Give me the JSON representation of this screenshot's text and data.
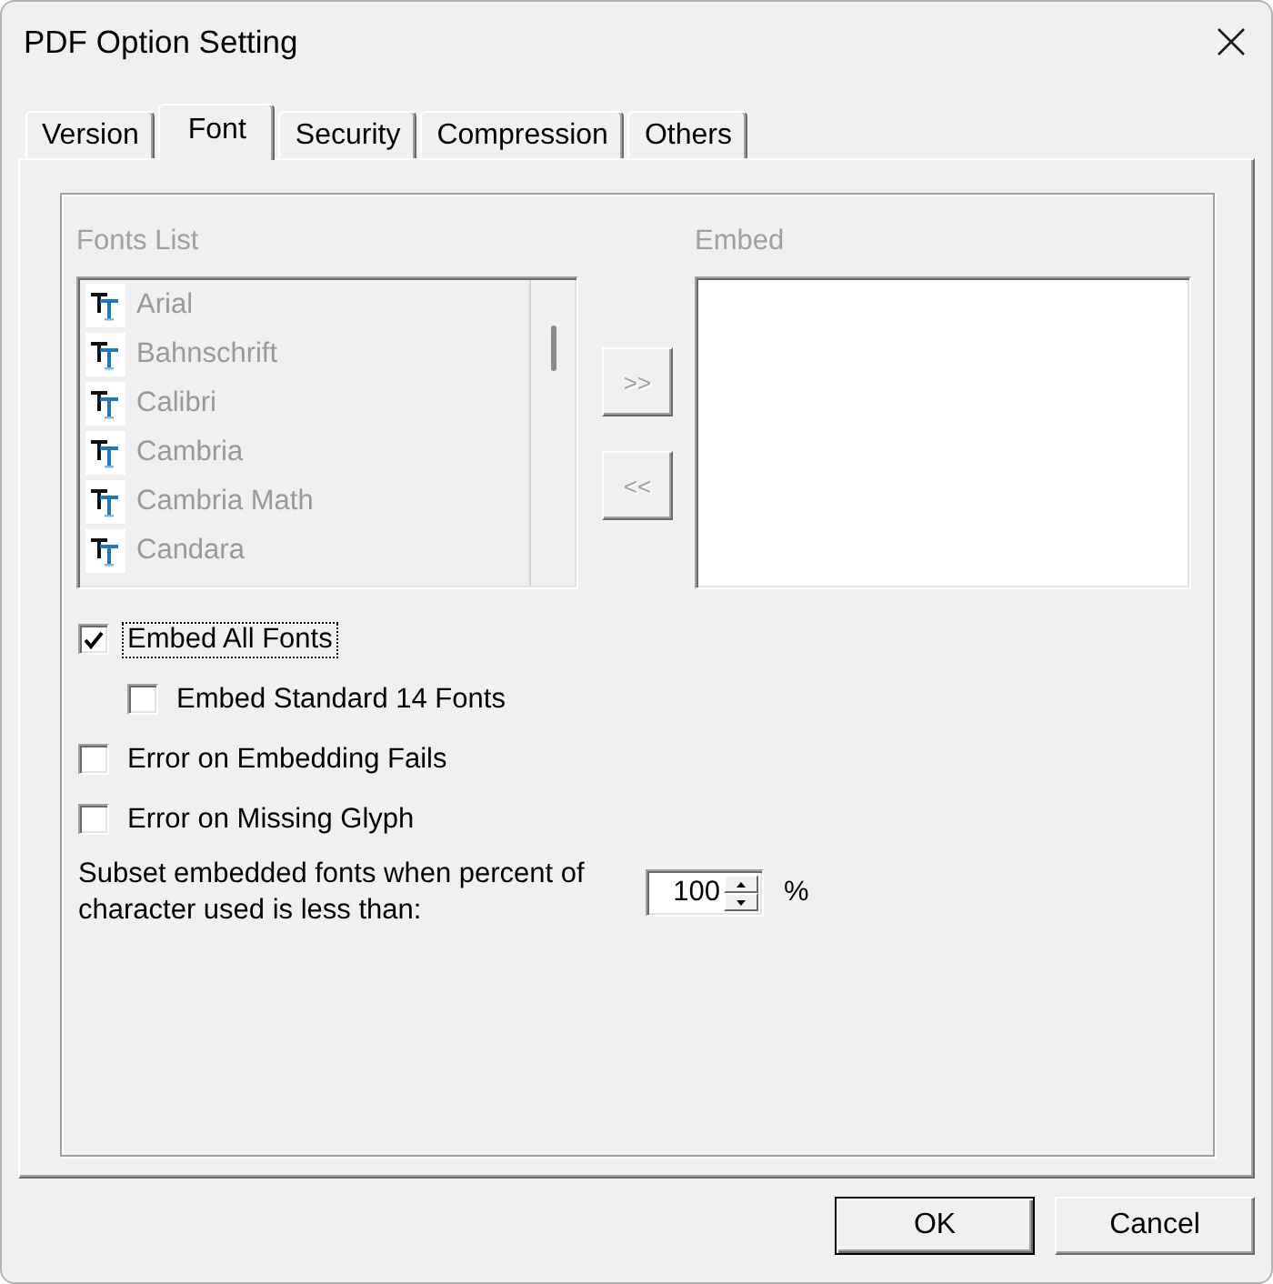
{
  "window": {
    "title": "PDF Option Setting"
  },
  "tabs": [
    {
      "label": "Version",
      "selected": false
    },
    {
      "label": "Font",
      "selected": true
    },
    {
      "label": "Security",
      "selected": false
    },
    {
      "label": "Compression",
      "selected": false
    },
    {
      "label": "Others",
      "selected": false
    }
  ],
  "fonts_list": {
    "label": "Fonts List",
    "disabled": true,
    "items": [
      "Arial",
      "Bahnschrift",
      "Calibri",
      "Cambria",
      "Cambria Math",
      "Candara"
    ]
  },
  "move_buttons": [
    {
      "label": ">>",
      "disabled": true
    },
    {
      "label": "<<",
      "disabled": true
    }
  ],
  "embed_list": {
    "label": "Embed",
    "disabled": true
  },
  "checkboxes": [
    {
      "label": "Embed All Fonts",
      "checked": true,
      "focused": true,
      "children": [
        {
          "label": "Embed Standard 14 Fonts",
          "checked": false,
          "focused": false
        }
      ]
    },
    {
      "label": "Error on Embedding Fails",
      "checked": false,
      "focused": false
    },
    {
      "label": "Error on Missing Glyph",
      "checked": false,
      "focused": false
    }
  ],
  "subset": {
    "label": "Subset embedded fonts when percent of character used is less than:",
    "value": "100",
    "unit": "%"
  },
  "buttons": [
    {
      "label": "OK",
      "default": true
    },
    {
      "label": "Cancel",
      "default": false
    }
  ]
}
